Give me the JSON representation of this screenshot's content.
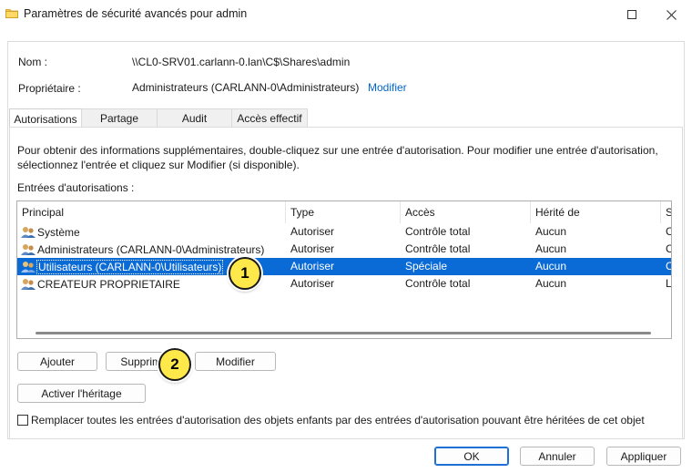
{
  "window": {
    "title": "Paramètres de sécurité avancés pour admin",
    "icon": "folder-icon"
  },
  "fields": {
    "name_label": "Nom :",
    "name_value": "\\\\CL0-SRV01.carlann-0.lan\\C$\\Shares\\admin",
    "owner_label": "Propriétaire :",
    "owner_value": "Administrateurs (CARLANN-0\\Administrateurs)",
    "owner_modify_link": "Modifier"
  },
  "tabs": [
    {
      "label": "Autorisations",
      "active": true
    },
    {
      "label": "Partage",
      "active": false
    },
    {
      "label": "Audit",
      "active": false
    },
    {
      "label": "Accès effectif",
      "active": false
    }
  ],
  "panel": {
    "help_text": "Pour obtenir des informations supplémentaires, double-cliquez sur une entrée d'autorisation. Pour modifier une entrée d'autorisation, sélectionnez l'entrée et cliquez sur Modifier (si disponible).",
    "list_label": "Entrées d'autorisations :"
  },
  "permissions_table": {
    "columns": [
      "Principal",
      "Type",
      "Accès",
      "Hérité de",
      "S"
    ],
    "rows": [
      {
        "principal": "Système",
        "type": "Autoriser",
        "access": "Contrôle total",
        "inherited": "Aucun",
        "applies": "C",
        "selected": false
      },
      {
        "principal": "Administrateurs (CARLANN-0\\Administrateurs)",
        "type": "Autoriser",
        "access": "Contrôle total",
        "inherited": "Aucun",
        "applies": "C",
        "selected": false
      },
      {
        "principal": "Utilisateurs (CARLANN-0\\Utilisateurs)",
        "type": "Autoriser",
        "access": "Spéciale",
        "inherited": "Aucun",
        "applies": "C",
        "selected": true
      },
      {
        "principal": "CREATEUR PROPRIETAIRE",
        "type": "Autoriser",
        "access": "Contrôle total",
        "inherited": "Aucun",
        "applies": "L",
        "selected": false
      }
    ]
  },
  "buttons": {
    "add": "Ajouter",
    "remove": "Supprimer",
    "modify": "Modifier",
    "enable_inheritance": "Activer l'héritage",
    "ok": "OK",
    "cancel": "Annuler",
    "apply": "Appliquer"
  },
  "checkbox": {
    "label": "Remplacer toutes les entrées d'autorisation des objets enfants par des entrées d'autorisation pouvant être héritées de cet objet",
    "checked": false
  },
  "annotations": [
    {
      "number": "1"
    },
    {
      "number": "2"
    }
  ],
  "colors": {
    "selection": "#0a6ad6",
    "link": "#0066cc",
    "badge": "#ffe94a",
    "primary_border": "#1e6fd6"
  }
}
